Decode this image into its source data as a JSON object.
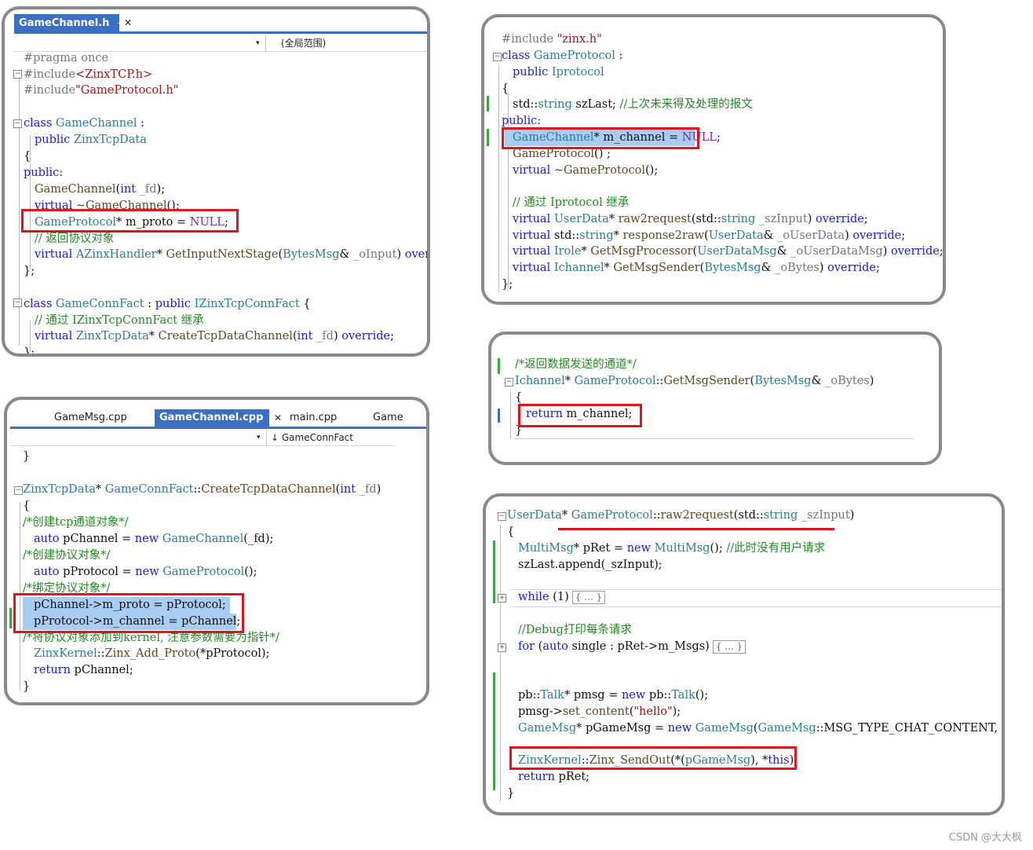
{
  "panel1": {
    "tab_active": "GameChannel.h",
    "tab_pin": "⊸",
    "tab_close": "✕",
    "nav_scope": "(全局范围)",
    "lines": [
      "#pragma once",
      "#include<ZinxTCP.h>",
      "#include\"GameProtocol.h\"",
      "",
      "class GameChannel :",
      "public ZinxTcpData",
      "{",
      "public:",
      "GameChannel(int _fd);",
      "virtual ~GameChannel();",
      "GameProtocol* m_proto = NULL;",
      "// 返回协议对象",
      "virtual AZinxHandler* GetInputNextStage(BytesMsg& _oInput) override;",
      "};",
      "",
      "class GameConnFact : public IZinxTcpConnFact {",
      "// 通过 IZinxTcpConnFact 继承",
      "virtual ZinxTcpData* CreateTcpDataChannel(int _fd) override;",
      "};"
    ]
  },
  "panel2": {
    "tabs": [
      "GameMsg.cpp",
      "GameChannel.cpp",
      "main.cpp",
      "Game"
    ],
    "tab_pin": "⊸",
    "tab_close": "✕",
    "nav_scope": "↓ GameConnFact",
    "lines": [
      "}",
      "",
      "ZinxTcpData* GameConnFact::CreateTcpDataChannel(int _fd)",
      "{",
      "/*创建tcp通道对象*/",
      "auto pChannel = new GameChannel(_fd);",
      "/*创建协议对象*/",
      "auto pProtocol = new GameProtocol();",
      "/*绑定协议对象*/",
      "pChannel->m_proto = pProtocol;",
      "pProtocol->m_channel = pChannel;",
      "/*将协议对象添加到kernel, 注意参数需要为指针*/",
      "ZinxKernel::Zinx_Add_Proto(*pProtocol);",
      "return pChannel;",
      "}"
    ]
  },
  "panel3": {
    "lines": [
      "#include \"zinx.h\"",
      "class GameProtocol :",
      "public Iprotocol",
      "{",
      "std::string szLast; //上次未来得及处理的报文",
      "public:",
      "GameChannel* m_channel = NULL;",
      "GameProtocol();",
      "virtual ~GameProtocol();",
      "",
      "// 通过 Iprotocol 继承",
      "virtual UserData* raw2request(std::string _szInput) override;",
      "virtual std::string* response2raw(UserData& _oUserData) override;",
      "virtual Irole* GetMsgProcessor(UserDataMsg& _oUserDataMsg) override;",
      "virtual Ichannel* GetMsgSender(BytesMsg& _oBytes) override;",
      "};"
    ]
  },
  "panel4": {
    "lines": [
      "/*返回数据发送的通道*/",
      "Ichannel* GameProtocol::GetMsgSender(BytesMsg& _oBytes)",
      "{",
      "return m_channel;",
      "}"
    ]
  },
  "panel5": {
    "collapsed_label": "{ ... }",
    "lines": [
      "UserData* GameProtocol::raw2request(std::string _szInput)",
      "{",
      "MultiMsg* pRet = new MultiMsg(); //此时没有用户请求",
      "szLast.append(_szInput);",
      "",
      "while (1)",
      "",
      "//Debug打印每条请求",
      "for (auto single : pRet->m_Msgs)",
      "",
      "",
      "pb::Talk* pmsg = new pb::Talk();",
      "pmsg->set_content(\"hello\");",
      "GameMsg* pGameMsg = new GameMsg(GameMsg::MSG_TYPE_CHAT_CONTENT, pmsg);",
      "",
      "ZinxKernel::Zinx_SendOut(*(pGameMsg), *this);",
      "return pRet;",
      "}"
    ]
  },
  "watermark": "CSDN @大大枫",
  "colors": {
    "accent": "#3a6fc4",
    "highlight_box": "#e0141e",
    "selection": "#a9cdf2"
  }
}
